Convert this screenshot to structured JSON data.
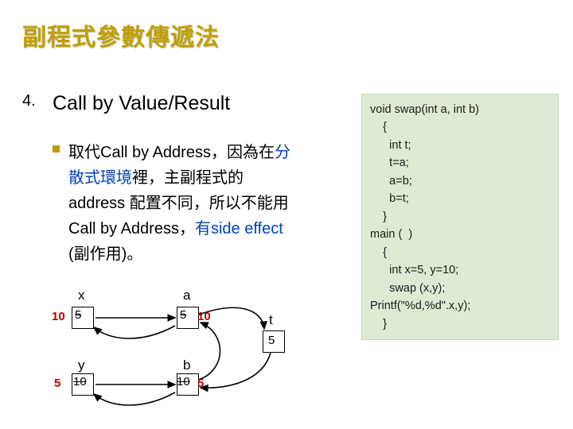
{
  "title": "副程式參數傳遞法",
  "list_number": "4.",
  "heading": "Call by Value/Result",
  "bullet": {
    "pre": "取代Call by Address，因為在",
    "blue1": "分散式環境",
    "mid1": "裡，主副程式的address 配置不同，所以不能用Call by Address，",
    "blue2": "有side effect",
    "mid2": " (副作用)。"
  },
  "diagram": {
    "labels": {
      "x": "x",
      "a": "a",
      "y": "y",
      "b": "b",
      "t": "t"
    },
    "vx_new": "10",
    "vx_old": "5",
    "va_old": "5",
    "va_new": "10",
    "vy_new": "5",
    "vy_old": "10",
    "vb_old": "10",
    "vb_new": "5",
    "vt": "5"
  },
  "code": "void swap(int a, int b)\n    {\n      int t;\n      t=a;\n      a=b;\n      b=t;\n    }\nmain (  )\n    {\n      int x=5, y=10;\n      swap (x,y);\nPrintf(\"%d,%d\".x,y);\n    }"
}
